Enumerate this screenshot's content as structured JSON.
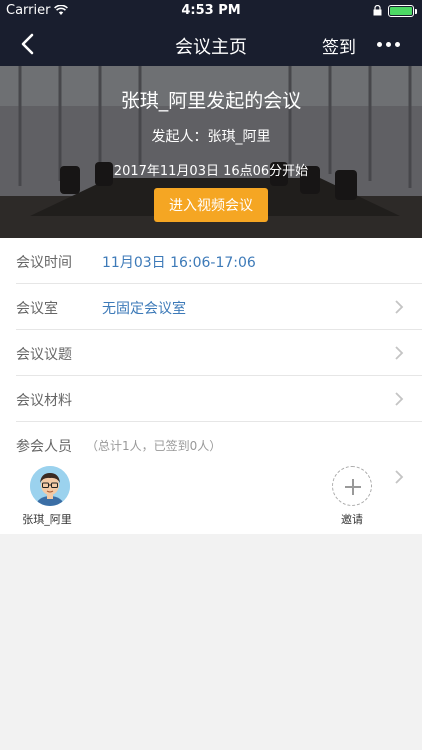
{
  "status_bar": {
    "carrier": "Carrier",
    "time": "4:53 PM",
    "battery_level": 1.0
  },
  "nav": {
    "title": "会议主页",
    "signin_label": "签到",
    "back_icon": "chevron-left-icon",
    "more_icon": "more-icon"
  },
  "banner": {
    "meeting_title": "张琪_阿里发起的会议",
    "initiator": "发起人：张琪_阿里",
    "start_time": "2017年11月03日 16点06分开始",
    "join_button": "进入视频会议"
  },
  "details": {
    "time": {
      "label": "会议时间",
      "value": "11月03日 16:06-17:06"
    },
    "room": {
      "label": "会议室",
      "value": "无固定会议室"
    },
    "topics": {
      "label": "会议议题"
    },
    "materials": {
      "label": "会议材料"
    }
  },
  "attendees": {
    "label": "参会人员",
    "summary": "（总计1人，已签到0人）",
    "people": [
      {
        "name": "张琪_阿里"
      }
    ],
    "invite_label": "邀请"
  },
  "colors": {
    "navbar": "#191e2e",
    "accent_orange": "#f5a623",
    "link_blue": "#3d7ab8",
    "background": "#f2f2f2"
  }
}
